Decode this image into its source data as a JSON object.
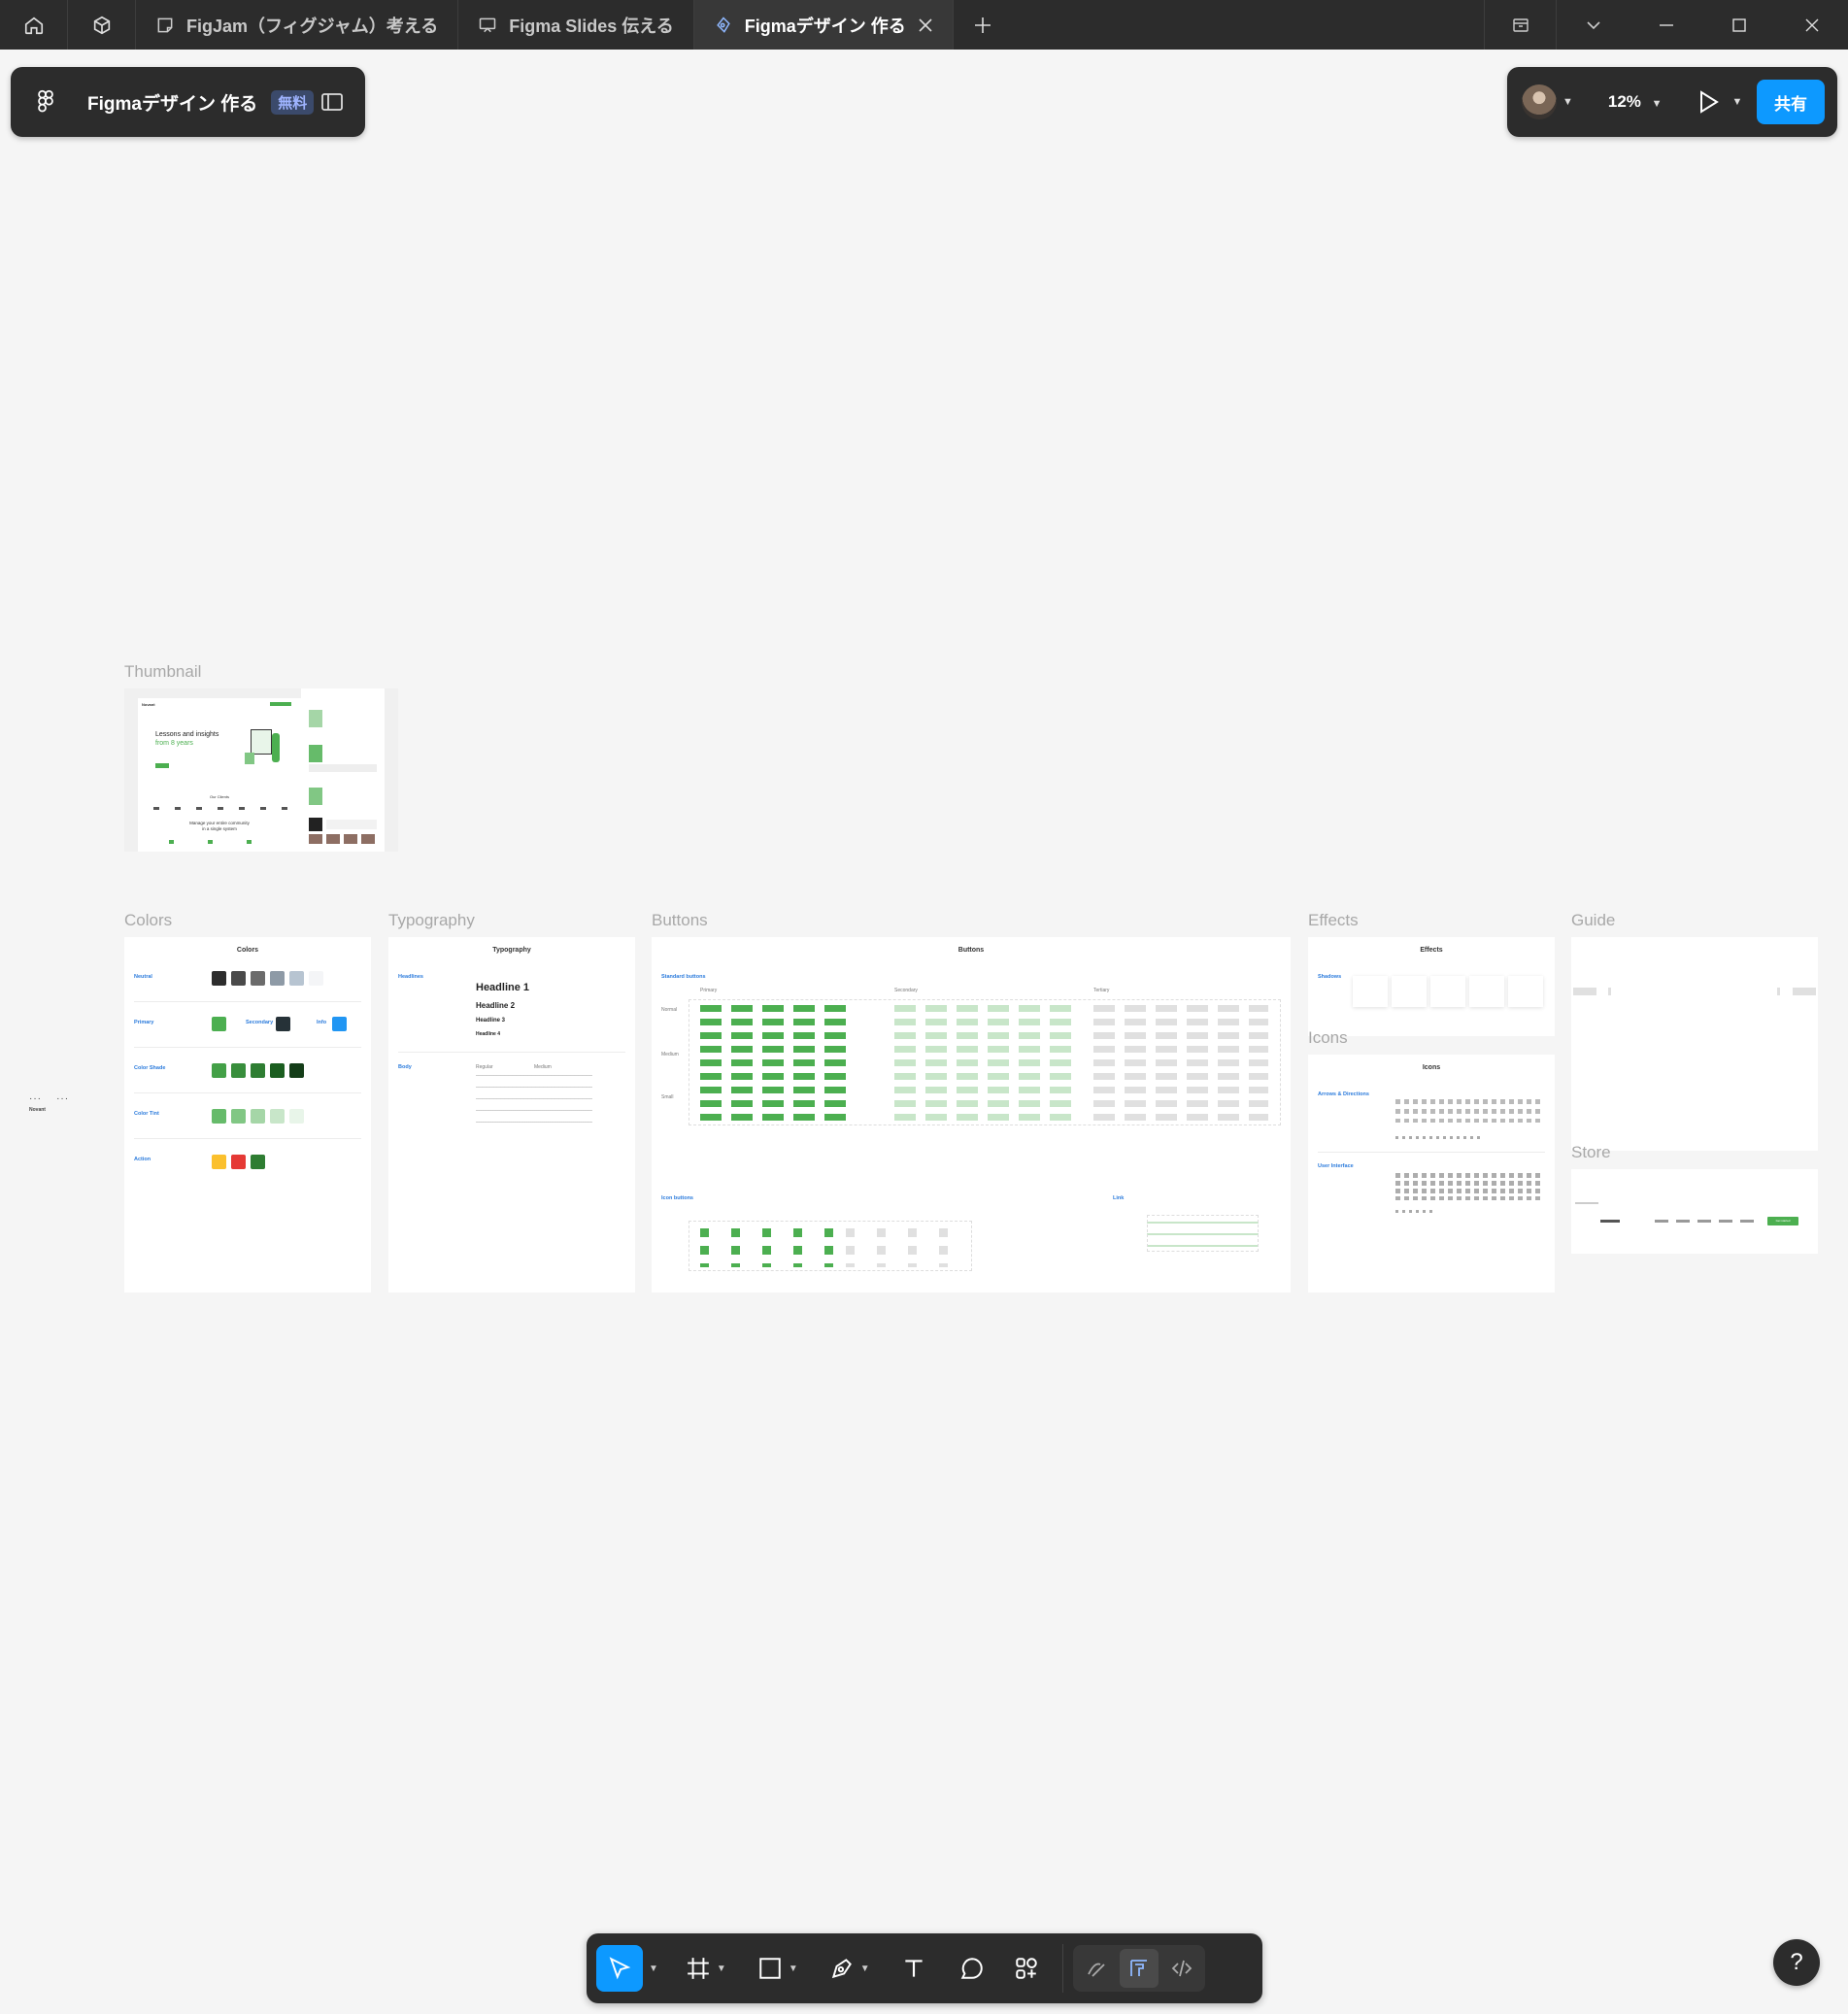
{
  "titlebar": {
    "tabs": [
      {
        "label": "FigJam（フィグジャム）考える",
        "icon": "figjam-icon"
      },
      {
        "label": "Figma Slides 伝える",
        "icon": "slides-icon"
      },
      {
        "label": "Figmaデザイン 作る",
        "icon": "design-icon",
        "active": true
      }
    ]
  },
  "file": {
    "title": "Figmaデザイン 作る",
    "badge": "無料"
  },
  "toolbar_right": {
    "zoom": "12%",
    "share_label": "共有"
  },
  "canvas": {
    "frames": {
      "thumbnail": {
        "label": "Thumbnail",
        "brand": "Novant",
        "headline_1": "Lessons and insights",
        "headline_2": "from 8 years",
        "clients": "Our Clients",
        "manage_1": "Manage your entire community",
        "manage_2": "in a single system"
      },
      "colors": {
        "label": "Colors",
        "title": "Colors",
        "rows": [
          "Neutral",
          "Primary",
          "Color Shade",
          "Color Tint",
          "Action"
        ],
        "secondary": "Secondary",
        "info": "Info"
      },
      "typography": {
        "label": "Typography",
        "title": "Typography",
        "headlines": "Headlines",
        "body": "Body",
        "h1": "Headline 1",
        "h2": "Headline 2",
        "h3": "Headline 3",
        "h4": "Headline 4",
        "regular": "Regular",
        "medium": "Medium"
      },
      "buttons": {
        "label": "Buttons",
        "title": "Buttons",
        "standard": "Standard buttons",
        "icon": "Icon buttons",
        "link": "Link",
        "primary": "Primary",
        "secondary": "Secondary",
        "tertiary": "Tertiary",
        "sizes": [
          "Normal",
          "Medium",
          "Small"
        ]
      },
      "effects": {
        "label": "Effects",
        "title": "Effects",
        "shadows": "Shadows"
      },
      "icons": {
        "label": "Icons",
        "title": "Icons",
        "arrows": "Arrows & Directions",
        "ui": "User Interface"
      },
      "guide": {
        "label": "Guide"
      },
      "store": {
        "label": "Store",
        "button": "Get started"
      }
    },
    "side_brand": "Novant"
  },
  "colors": {
    "accent": "#0d99ff",
    "panel": "#2c2c2c",
    "green": "#4caf50"
  }
}
